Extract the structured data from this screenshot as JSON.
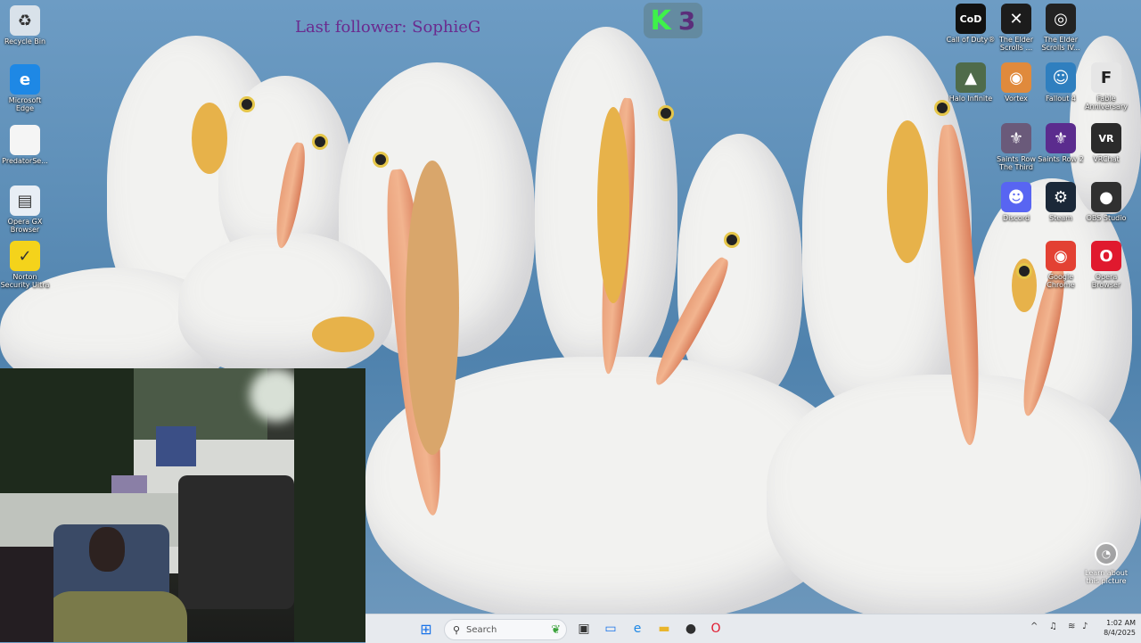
{
  "overlay": {
    "follower_text": "Last follower: SophieG",
    "logo_letter": "K",
    "logo_number": "3"
  },
  "desktop_left": [
    {
      "label": "Recycle Bin",
      "icon": "recycle-bin-icon",
      "glyph": "♻",
      "color": "#d9e2ea"
    },
    {
      "label": "Microsoft Edge",
      "icon": "edge-icon",
      "glyph": "e",
      "color": "#1e88e5"
    },
    {
      "label": "PredatorSe...",
      "icon": "file-icon",
      "glyph": "",
      "color": "#f5f5f5"
    },
    {
      "label": "Opera GX Browser",
      "icon": "opera-gx-icon",
      "glyph": "▤",
      "color": "#e8eef5"
    },
    {
      "label": "Norton Security Ultra",
      "icon": "norton-icon",
      "glyph": "✓",
      "color": "#f4d31b"
    }
  ],
  "desktop_right": [
    {
      "label": "Call of Duty®",
      "icon": "call-of-duty-icon",
      "glyph": "CoD",
      "color": "#111111"
    },
    {
      "label": "The Elder Scrolls ...",
      "icon": "elder-scrolls-icon",
      "glyph": "✕",
      "color": "#1c1c1c"
    },
    {
      "label": "The Elder Scrolls IV...",
      "icon": "oblivion-icon",
      "glyph": "◎",
      "color": "#222222"
    },
    {
      "label": "Halo Infinite",
      "icon": "halo-icon",
      "glyph": "▲",
      "color": "#4f6b4a"
    },
    {
      "label": "Vortex",
      "icon": "vortex-icon",
      "glyph": "◉",
      "color": "#e08a3c"
    },
    {
      "label": "Fallout 4",
      "icon": "fallout-icon",
      "glyph": "☺",
      "color": "#2f7fbf"
    },
    {
      "label": "Fable Anniversary",
      "icon": "fable-icon",
      "glyph": "F",
      "color": "#e6e6e6"
    },
    {
      "label": "Saints Row The Third",
      "icon": "saints-row-3-icon",
      "glyph": "⚜",
      "color": "#6a5a7a"
    },
    {
      "label": "Saints Row 2",
      "icon": "saints-row-2-icon",
      "glyph": "⚜",
      "color": "#5b2c8e"
    },
    {
      "label": "VRChat",
      "icon": "vrchat-icon",
      "glyph": "VR",
      "color": "#2b2b2b"
    },
    {
      "label": "Discord",
      "icon": "discord-icon",
      "glyph": "☻",
      "color": "#5865f2"
    },
    {
      "label": "Steam",
      "icon": "steam-icon",
      "glyph": "⚙",
      "color": "#1b2838"
    },
    {
      "label": "OBS Studio",
      "icon": "obs-icon",
      "glyph": "●",
      "color": "#303030"
    },
    {
      "label": "Google Chrome",
      "icon": "chrome-icon",
      "glyph": "◉",
      "color": "#e34133"
    },
    {
      "label": "Opera Browser",
      "icon": "opera-icon",
      "glyph": "O",
      "color": "#e0192e"
    }
  ],
  "learn": {
    "label": "Learn about this picture"
  },
  "taskbar": {
    "search_placeholder": "Search",
    "time": "1:02 AM",
    "date": "8/4/2025",
    "items": [
      {
        "icon": "start-icon",
        "glyph": "⊞",
        "color": "#1a73e8"
      },
      {
        "icon": "widgets-icon",
        "glyph": "❦",
        "color": "#3da33d"
      },
      {
        "icon": "task-view-icon",
        "glyph": "▣",
        "color": "#333333"
      },
      {
        "icon": "window-icon",
        "glyph": "▭",
        "color": "#1a73e8"
      },
      {
        "icon": "edge-taskbar-icon",
        "glyph": "e",
        "color": "#1e88e5"
      },
      {
        "icon": "file-explorer-icon",
        "glyph": "▬",
        "color": "#e9b52b"
      },
      {
        "icon": "obs-taskbar-icon",
        "glyph": "●",
        "color": "#303030"
      },
      {
        "icon": "opera-taskbar-icon",
        "glyph": "O",
        "color": "#e0192e"
      }
    ],
    "tray": [
      {
        "icon": "chevron-up-icon",
        "glyph": "^"
      },
      {
        "icon": "microphone-icon",
        "glyph": "♫"
      },
      {
        "icon": "wifi-icon",
        "glyph": "≋"
      },
      {
        "icon": "speaker-icon",
        "glyph": "♪"
      }
    ]
  }
}
